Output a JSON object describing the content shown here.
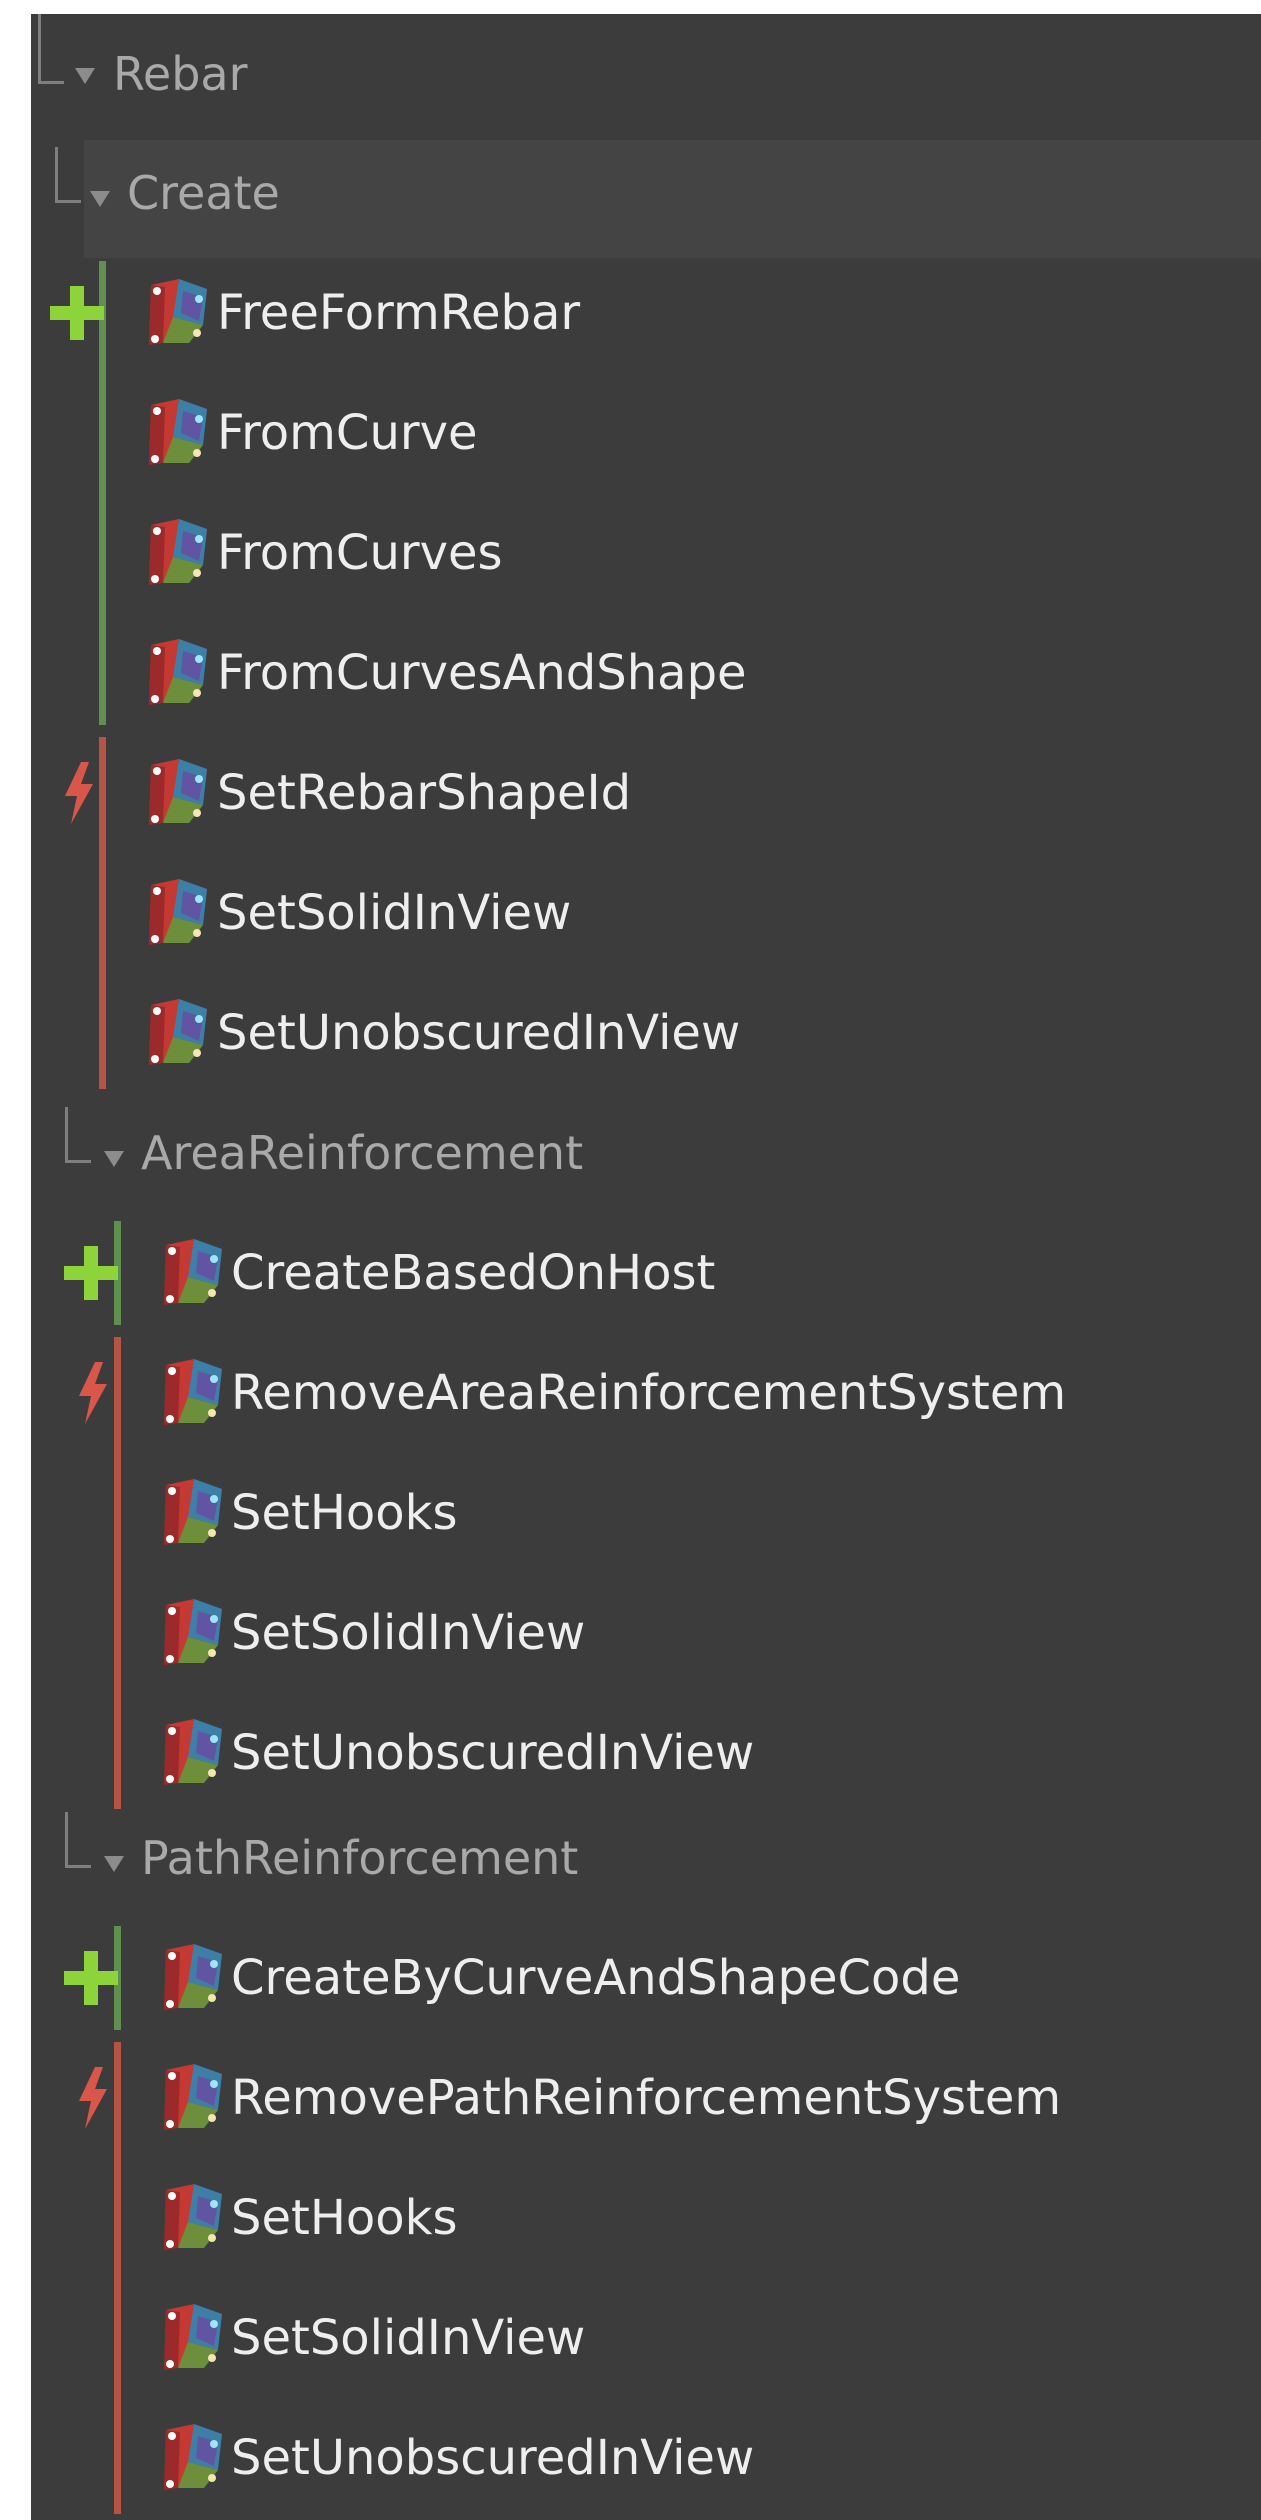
{
  "tree": {
    "category": "Rebar",
    "groups": [
      {
        "label": "Create",
        "items": [
          {
            "label": "FreeFormRebar",
            "kind": "create"
          },
          {
            "label": "FromCurve",
            "kind": "create"
          },
          {
            "label": "FromCurves",
            "kind": "create"
          },
          {
            "label": "FromCurvesAndShape",
            "kind": "create"
          },
          {
            "label": "SetRebarShapeId",
            "kind": "action"
          },
          {
            "label": "SetSolidInView",
            "kind": "action"
          },
          {
            "label": "SetUnobscuredInView",
            "kind": "action"
          }
        ]
      },
      {
        "label": "AreaReinforcement",
        "items": [
          {
            "label": "CreateBasedOnHost",
            "kind": "create"
          },
          {
            "label": "RemoveAreaReinforcementSystem",
            "kind": "action"
          },
          {
            "label": "SetHooks",
            "kind": "action"
          },
          {
            "label": "SetSolidInView",
            "kind": "action"
          },
          {
            "label": "SetUnobscuredInView",
            "kind": "action"
          }
        ]
      },
      {
        "label": "PathReinforcement",
        "items": [
          {
            "label": "CreateByCurveAndShapeCode",
            "kind": "create"
          },
          {
            "label": "RemovePathReinforcementSystem",
            "kind": "action"
          },
          {
            "label": "SetHooks",
            "kind": "action"
          },
          {
            "label": "SetSolidInView",
            "kind": "action"
          },
          {
            "label": "SetUnobscuredInView",
            "kind": "action"
          }
        ]
      }
    ]
  },
  "icons": {
    "create_marker": "plus-icon",
    "action_marker": "lightning-bolt-icon",
    "node": "dynamo-node-icon",
    "expand": "caret-down-icon"
  },
  "colors": {
    "panel_background": "#3c3c3c",
    "create_accent": "#60904f",
    "action_accent": "#b55444",
    "plus": "#8cd43a",
    "bolt": "#d9574a",
    "item_text": "#eeeeee",
    "category_text": "#a9a9a9"
  }
}
